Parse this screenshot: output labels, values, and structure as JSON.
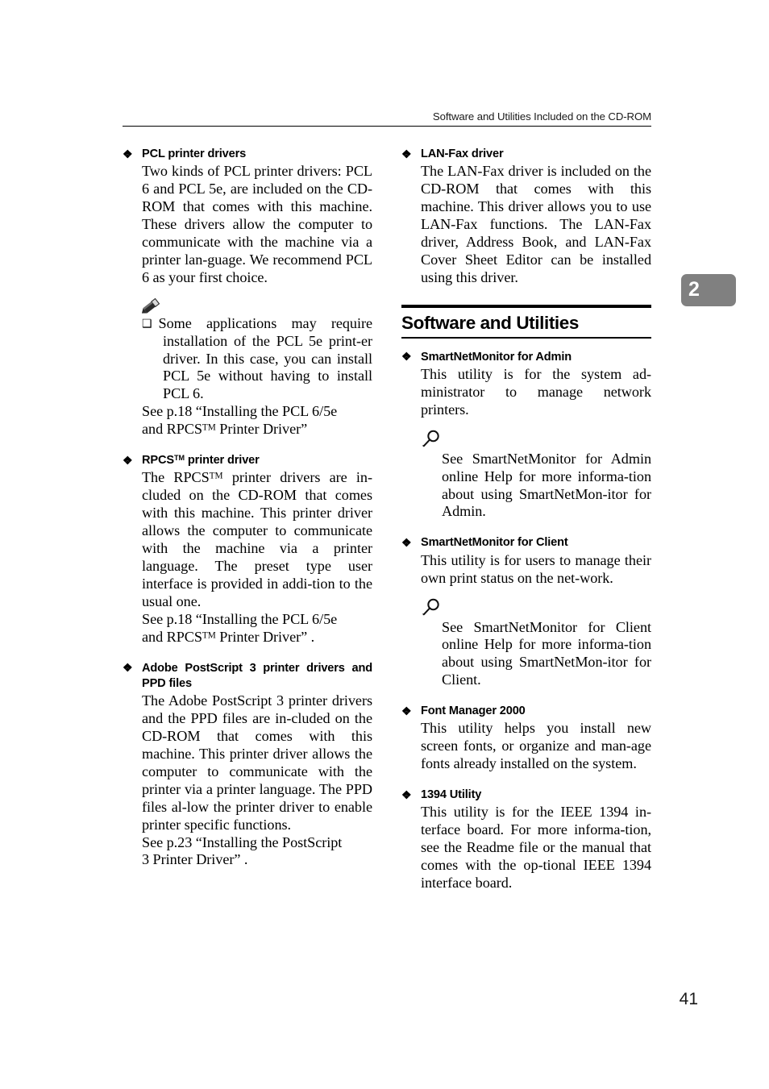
{
  "page": {
    "running_header": "Software and Utilities Included on the CD-ROM",
    "chapter_tab": "2",
    "folio": "41"
  },
  "icons": {
    "diamond": "❖",
    "note_square": "❑",
    "pencil": "pencil-icon",
    "magnifier": "magnifier-icon"
  },
  "left_column": {
    "entries": [
      {
        "title": "PCL printer drivers",
        "body": "Two kinds of PCL printer drivers: PCL 6 and PCL 5e, are included on the CD-ROM that comes with this machine. These drivers allow the computer to communicate with the machine via a printer lan-guage. We recommend PCL 6 as your first choice.",
        "note": "Some applications may require installation of the PCL 5e print-er driver. In this case, you can install PCL 5e without having to install PCL 6.",
        "see_line1": "See p.18 “Installing the PCL 6/5e",
        "see_line2_pre": "and RPCS",
        "see_line2_post": " Printer Driver”"
      },
      {
        "title_pre": "RPCS",
        "title_post": " printer driver",
        "body_pre": "The RPCS",
        "body_post": " printer drivers are in-cluded on the CD-ROM that comes with this machine. This printer driver allows the computer to communicate with the machine via a printer language. The preset type user interface is provided in addi-tion to the usual one.",
        "see_line1": "See p.18 “Installing the PCL 6/5e",
        "see_line2_pre": "and RPCS",
        "see_line2_post": " Printer Driver” ."
      },
      {
        "title": "Adobe PostScript 3 printer drivers and PPD files",
        "body": "The Adobe PostScript 3 printer drivers and the PPD files are in-cluded on the CD-ROM that comes with this machine. This printer driver allows the computer to communicate with the printer via a printer language. The PPD files al-low the printer driver to enable printer specific functions.",
        "see_line1": "See p.23 “Installing the PostScript",
        "see_line2": "3 Printer Driver” ."
      }
    ]
  },
  "right_column": {
    "lan_fax": {
      "title": "LAN-Fax driver",
      "body": "The LAN-Fax driver is included on the CD-ROM that comes with this machine. This driver allows you to use LAN-Fax functions. The LAN-Fax driver, Address Book, and LAN-Fax Cover Sheet Editor can be installed using this driver."
    },
    "section_heading": "Software and Utilities",
    "entries": [
      {
        "title": "SmartNetMonitor for Admin",
        "body": "This utility is for the system ad-ministrator to manage network printers.",
        "reference": "See SmartNetMonitor for Admin online Help for more informa-tion about using SmartNetMon-itor for Admin."
      },
      {
        "title": "SmartNetMonitor for Client",
        "body": "This utility is for users to manage their own print status on the net-work.",
        "reference": "See SmartNetMonitor for Client online Help for more informa-tion about using SmartNetMon-itor for Client."
      },
      {
        "title": "Font Manager 2000",
        "body": "This utility helps you install new screen fonts, or organize and man-age fonts already installed on the system."
      },
      {
        "title": "1394 Utility",
        "body": "This utility is for the IEEE 1394 in-terface board. For more informa-tion, see the Readme file or the manual that comes with the op-tional IEEE 1394 interface board."
      }
    ]
  }
}
